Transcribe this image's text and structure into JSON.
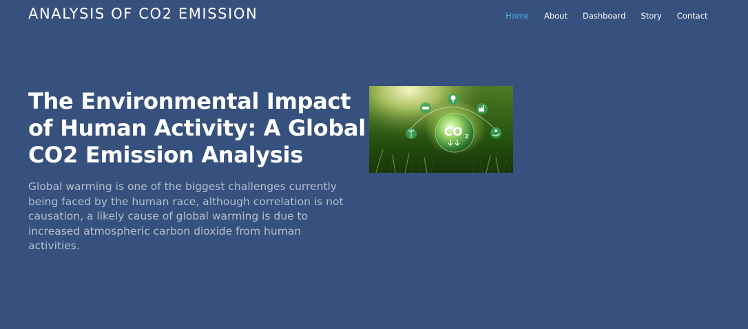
{
  "header": {
    "logo": "ANALYSIS OF CO2 EMISSION",
    "nav": [
      {
        "label": "Home",
        "active": true
      },
      {
        "label": "About",
        "active": false
      },
      {
        "label": "Dashboard",
        "active": false
      },
      {
        "label": "Story",
        "active": false
      },
      {
        "label": "Contact",
        "active": false
      }
    ]
  },
  "hero": {
    "title": "The Environmental Impact of Human Activity: A Global CO2 Emission Analysis",
    "description": "Global warming is one of the biggest challenges currently being faced by the human race, although correlation is not causation, a likely cause of global warming is due to increased atmospheric carbon dioxide from human activities.",
    "image": {
      "label": "CO2",
      "icons": [
        "car-icon",
        "factory-icon",
        "tree-icon",
        "wind-turbine-icon",
        "eco-hand-icon"
      ]
    }
  },
  "colors": {
    "background": "#37517e",
    "nav_active": "#47b2e4",
    "text": "#ffffff"
  }
}
